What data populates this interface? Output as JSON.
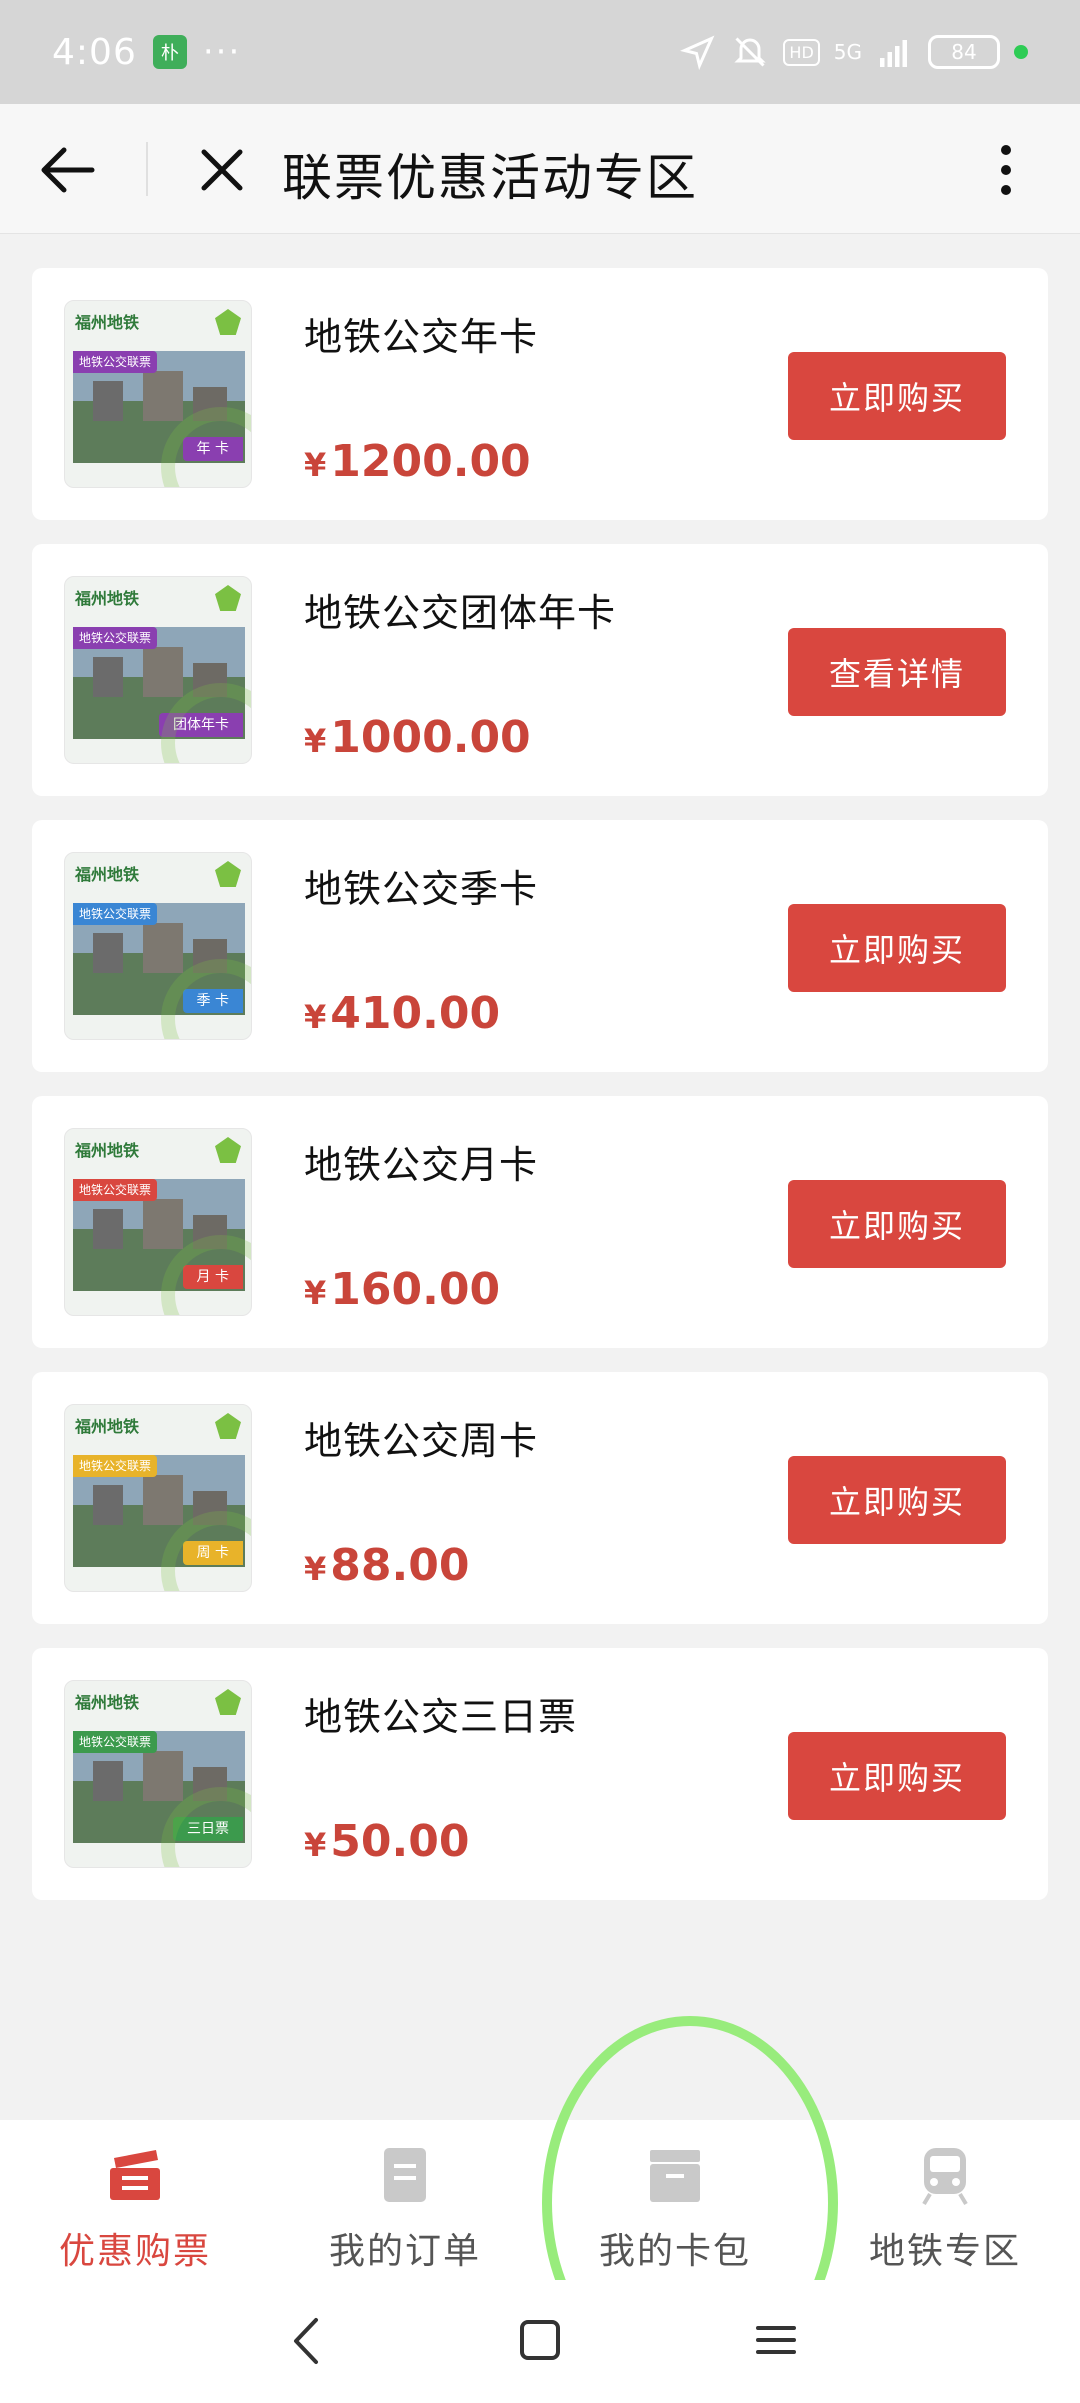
{
  "status_bar": {
    "time": "4:06",
    "badge": "朴",
    "dots": "···",
    "hd": "HD",
    "signal": "5G",
    "battery": "84"
  },
  "navbar": {
    "title": "联票优惠活动专区"
  },
  "products": [
    {
      "title": "地铁公交年卡",
      "currency": "¥",
      "price": "1200.00",
      "button": "立即购买",
      "thumb_strip": "地铁公交联票",
      "thumb_foot": "年 卡",
      "theme": "#8a3fb0"
    },
    {
      "title": "地铁公交团体年卡",
      "currency": "¥",
      "price": "1000.00",
      "button": "查看详情",
      "thumb_strip": "地铁公交联票",
      "thumb_foot": "团体年卡",
      "theme": "#8a3fb0"
    },
    {
      "title": "地铁公交季卡",
      "currency": "¥",
      "price": "410.00",
      "button": "立即购买",
      "thumb_strip": "地铁公交联票",
      "thumb_foot": "季 卡",
      "theme": "#3a86d4"
    },
    {
      "title": "地铁公交月卡",
      "currency": "¥",
      "price": "160.00",
      "button": "立即购买",
      "thumb_strip": "地铁公交联票",
      "thumb_foot": "月 卡",
      "theme": "#d9473f"
    },
    {
      "title": "地铁公交周卡",
      "currency": "¥",
      "price": "88.00",
      "button": "立即购买",
      "thumb_strip": "地铁公交联票",
      "thumb_foot": "周 卡",
      "theme": "#e8b32a"
    },
    {
      "title": "地铁公交三日票",
      "currency": "¥",
      "price": "50.00",
      "button": "立即购买",
      "thumb_strip": "地铁公交联票",
      "thumb_foot": "三日票",
      "theme": "#3c9a4d"
    }
  ],
  "thumb_logo": "福州地铁",
  "tabs": [
    {
      "label": "优惠购票",
      "icon": "ticket-icon",
      "active": true
    },
    {
      "label": "我的订单",
      "icon": "order-icon",
      "active": false
    },
    {
      "label": "我的卡包",
      "icon": "wallet-icon",
      "active": false
    },
    {
      "label": "地铁专区",
      "icon": "train-icon",
      "active": false
    }
  ],
  "colors": {
    "accent": "#d9473f",
    "price": "#c9453a",
    "highlight": "#98ec7c"
  }
}
